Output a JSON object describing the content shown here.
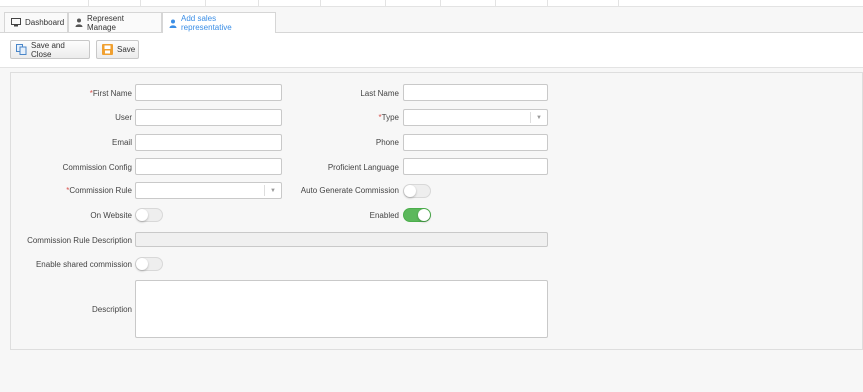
{
  "tabs": [
    {
      "label": "Dashboard",
      "icon": "monitor-icon",
      "active": false
    },
    {
      "label": "Represent Manage",
      "icon": "user-icon",
      "active": false
    },
    {
      "label": "Add sales representative",
      "icon": "user-icon",
      "active": true
    }
  ],
  "toolbar": {
    "save_close_label": "Save and Close",
    "save_label": "Save"
  },
  "form": {
    "first_name": {
      "label": "First Name",
      "required": true,
      "value": ""
    },
    "last_name": {
      "label": "Last Name",
      "required": false,
      "value": ""
    },
    "user": {
      "label": "User",
      "value": ""
    },
    "type": {
      "label": "Type",
      "required": true,
      "value": ""
    },
    "email": {
      "label": "Email",
      "value": ""
    },
    "phone": {
      "label": "Phone",
      "value": ""
    },
    "commission_config": {
      "label": "Commission Config",
      "value": ""
    },
    "proficient_language": {
      "label": "Proficient Language",
      "value": ""
    },
    "commission_rule": {
      "label": "Commission Rule",
      "required": true,
      "value": ""
    },
    "auto_generate_commission": {
      "label": "Auto Generate Commission",
      "on": false
    },
    "on_website": {
      "label": "On Website",
      "on": false
    },
    "enabled": {
      "label": "Enabled",
      "on": true
    },
    "commission_rule_description": {
      "label": "Commission Rule Description",
      "value": ""
    },
    "enable_shared_commission": {
      "label": "Enable shared commission",
      "on": false
    },
    "description": {
      "label": "Description",
      "value": ""
    }
  },
  "colors": {
    "accent": "#3a8ee6",
    "toggle_on": "#5cb85c",
    "required": "#d9534f"
  }
}
